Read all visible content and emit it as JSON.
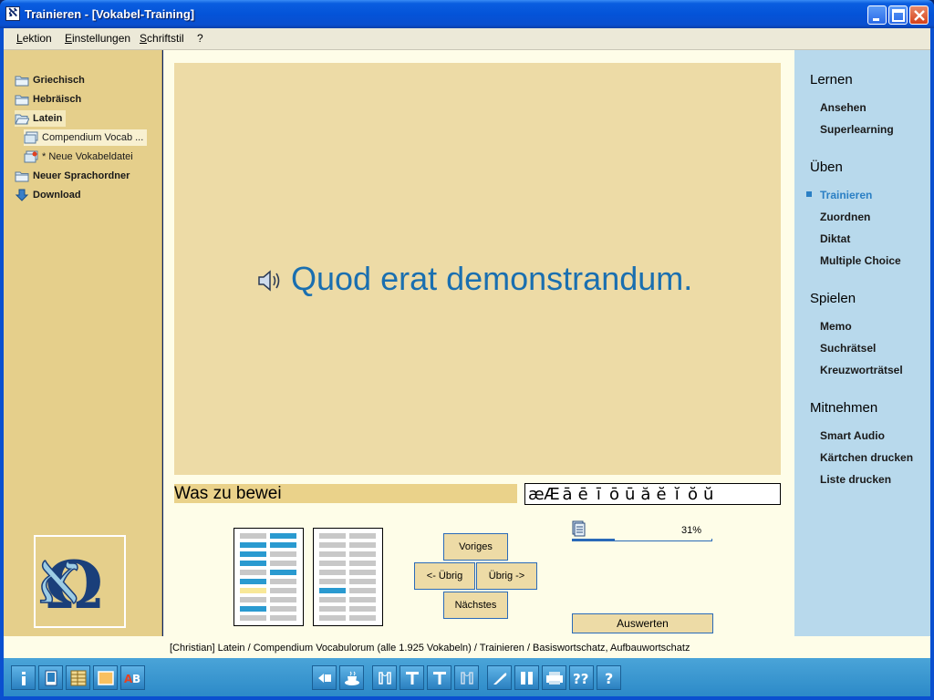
{
  "window": {
    "title": "Trainieren - [Vokabel-Training]",
    "icon_letter": "ℵ"
  },
  "menu": [
    "Lektion",
    "Einstellungen",
    "Schriftstil",
    "?"
  ],
  "tree": [
    {
      "label": "Griechisch",
      "icon": "folder-icon",
      "bold": true
    },
    {
      "label": "Hebräisch",
      "icon": "folder-icon",
      "bold": true
    },
    {
      "label": "Latein",
      "icon": "open-folder-icon",
      "bold": true,
      "selected": true
    },
    {
      "label": "Compendium Vocab ...",
      "icon": "vocab-file-icon",
      "bold": false,
      "selected": true,
      "child": true
    },
    {
      "label": "* Neue Vokabeldatei",
      "icon": "new-vocab-file-icon",
      "bold": false,
      "child": true
    },
    {
      "label": "Neuer Sprachordner",
      "icon": "folder-icon",
      "bold": true
    },
    {
      "label": "Download",
      "icon": "download-arrow-icon",
      "bold": true
    }
  ],
  "card": {
    "phrase": "Quod erat demonstrandum."
  },
  "answer": {
    "value": "Was zu bewei"
  },
  "special_chars": [
    "æ",
    "Æ",
    "ā",
    "ē",
    "ī",
    "ō",
    "ū",
    "ă",
    "ĕ",
    "ĭ",
    "ŏ",
    "ŭ"
  ],
  "nav": {
    "previous": "Voriges",
    "left": "<- Übrig",
    "right": "Übrig ->",
    "next": "Nächstes"
  },
  "progress": {
    "percent_label": "31%",
    "fraction": 0.31
  },
  "evaluate": "Auswerten",
  "rightbar": {
    "sections": [
      {
        "title": "Lernen",
        "items": [
          "Ansehen",
          "Superlearning"
        ]
      },
      {
        "title": "Üben",
        "items": [
          "Trainieren",
          "Zuordnen",
          "Diktat",
          "Multiple Choice"
        ]
      },
      {
        "title": "Spielen",
        "items": [
          "Memo",
          "Suchrätsel",
          "Kreuzworträtsel"
        ]
      },
      {
        "title": "Mitnehmen",
        "items": [
          "Smart Audio",
          "Kärtchen drucken",
          "Liste drucken"
        ]
      }
    ],
    "active": "Trainieren"
  },
  "status": "[Christian]  Latein / Compendium Vocabulorum  (alle 1.925 Vokabeln) / Trainieren / Basiswortschatz, Aufbauwortschatz",
  "toolbar": {
    "left": [
      "info-icon",
      "book-icon",
      "list-icon",
      "card-icon",
      "ab-icon"
    ],
    "right": [
      "back-icon",
      "coffee-icon",
      "frame-icon",
      "text-t-icon",
      "text-t-bold-icon",
      "frame-outline-icon",
      "quill-icon",
      "columns-icon",
      "printer-icon",
      "questions-icon",
      "help-icon"
    ]
  },
  "colors": {
    "card_bg": "#eddba6",
    "phrase": "#1a6fb0",
    "sidebar": "#e5cf8b",
    "rightbar": "#b8d9ec",
    "accent": "#2a7fc4"
  }
}
